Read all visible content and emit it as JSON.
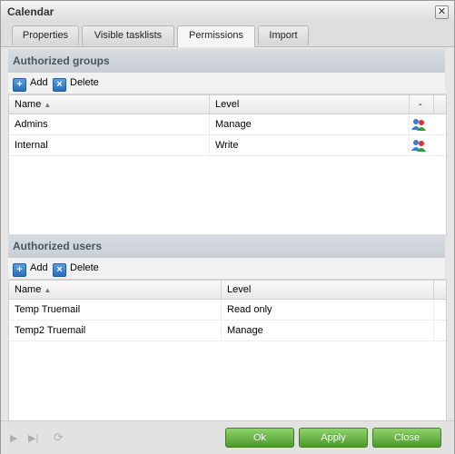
{
  "window": {
    "title": "Calendar"
  },
  "tabs": [
    {
      "label": "Properties"
    },
    {
      "label": "Visible tasklists"
    },
    {
      "label": "Permissions",
      "active": true
    },
    {
      "label": "Import"
    }
  ],
  "groups": {
    "title": "Authorized groups",
    "toolbar": {
      "add_label": "Add",
      "delete_label": "Delete"
    },
    "columns": {
      "name": "Name",
      "level": "Level",
      "action": "-"
    },
    "rows": [
      {
        "name": "Admins",
        "level": "Manage"
      },
      {
        "name": "Internal",
        "level": "Write"
      }
    ]
  },
  "users": {
    "title": "Authorized users",
    "toolbar": {
      "add_label": "Add",
      "delete_label": "Delete"
    },
    "columns": {
      "name": "Name",
      "level": "Level"
    },
    "rows": [
      {
        "name": "Temp Truemail",
        "level": "Read only"
      },
      {
        "name": "Temp2 Truemail",
        "level": "Manage"
      }
    ]
  },
  "buttons": {
    "ok_label": "Ok",
    "apply_label": "Apply",
    "close_label": "Close"
  },
  "colors": {
    "accent_green": "#5aab37",
    "section_header": "#c8ced4"
  }
}
